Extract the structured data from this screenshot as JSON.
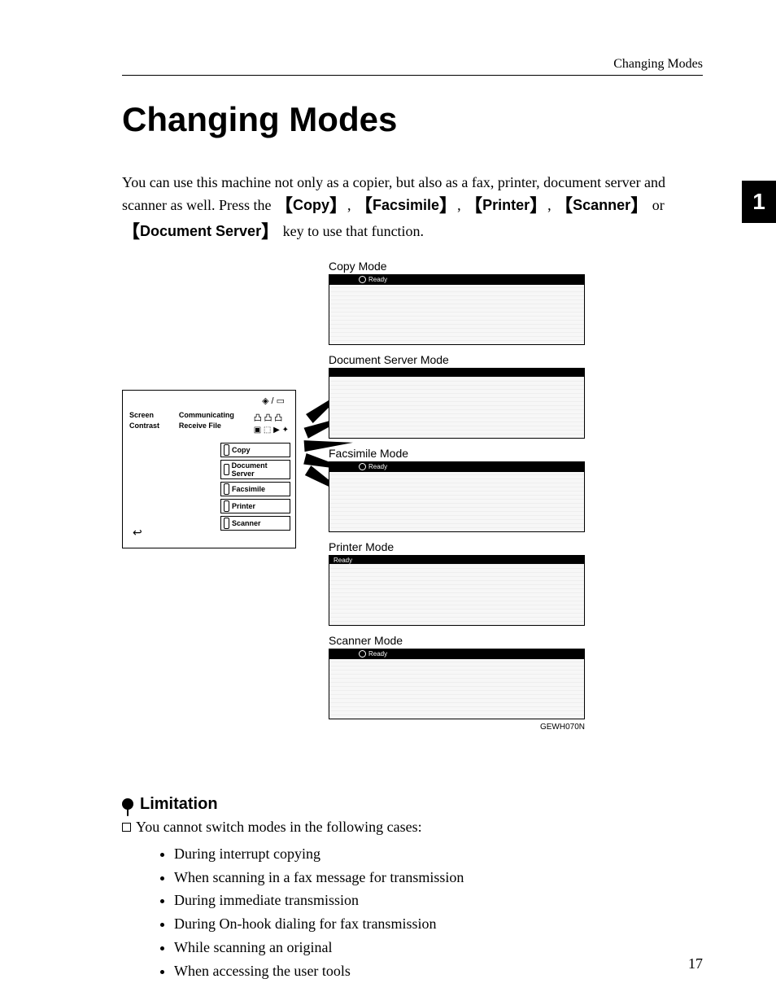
{
  "header": {
    "running_head": "Changing Modes"
  },
  "thumb_tab": "1",
  "title": "Changing Modes",
  "intro": {
    "line1": "You can use this machine not only as a copier, but also as a fax, printer, document server and scanner as well. Press the ",
    "key1": "Copy",
    "sep": ", ",
    "key2": "Facsimile",
    "key3": "Printer",
    "key4": "Scanner",
    "or": " or ",
    "key5": "Document Server",
    "line2": " key to use that function."
  },
  "panel": {
    "labels_left": [
      "Screen",
      "Contrast"
    ],
    "labels_mid_top": "Communicating",
    "labels_mid_bot": "Receive File",
    "mode_buttons": [
      "Copy",
      "Document Server",
      "Facsimile",
      "Printer",
      "Scanner"
    ],
    "top_icons": "◈/▭"
  },
  "screens": {
    "modes": [
      {
        "title": "Copy Mode",
        "ready": "Ready"
      },
      {
        "title": "Document Server Mode",
        "ready": ""
      },
      {
        "title": "Facsimile Mode",
        "ready": "Ready"
      },
      {
        "title": "Printer Mode",
        "ready": "Ready"
      },
      {
        "title": "Scanner Mode",
        "ready": "Ready"
      }
    ],
    "figure_code": "GEWH070N"
  },
  "limitation": {
    "heading": "Limitation",
    "lead": "You cannot switch modes in the following cases:",
    "items": [
      "During interrupt copying",
      "When scanning in a fax message for transmission",
      "During immediate transmission",
      "During On-hook dialing for fax transmission",
      "While scanning an original",
      "When accessing the user tools"
    ]
  },
  "page_number": "17"
}
